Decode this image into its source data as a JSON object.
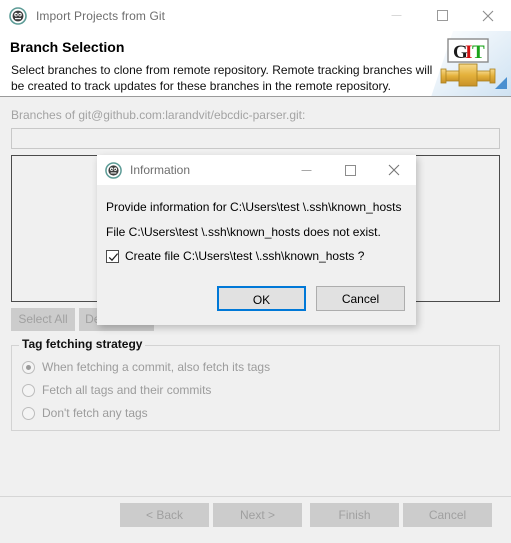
{
  "window": {
    "title": "Import Projects from Git",
    "icon": "git-repository-icon",
    "controls": {
      "minimize": "minimize-icon",
      "maximize": "maximize-icon",
      "close": "close-icon"
    }
  },
  "wizard": {
    "title": "Branch Selection",
    "description": "Select branches to clone from remote repository. Remote tracking branches will be created to track updates for these branches in the remote repository.",
    "banner_icon": "git-banner-icon",
    "banner_letters": {
      "g": "G",
      "i": "I",
      "t": "T"
    }
  },
  "page": {
    "branches_label": "Branches of git@github.com:larandvit/ebcdic-parser.git:",
    "filter_value": "",
    "filter_placeholder": "",
    "branch_list_items": [],
    "select_all_label": "Select All",
    "deselect_all_label": "Deselect All"
  },
  "tag_group": {
    "title": "Tag fetching strategy",
    "options": [
      {
        "label": "When fetching a commit, also fetch its tags",
        "selected": true
      },
      {
        "label": "Fetch all tags and their commits",
        "selected": false
      },
      {
        "label": "Don't fetch any tags",
        "selected": false
      }
    ]
  },
  "footer": {
    "back_label": "< Back",
    "next_label": "Next >",
    "finish_label": "Finish",
    "cancel_label": "Cancel"
  },
  "dialog": {
    "title": "Information",
    "icon": "git-repository-icon",
    "controls": {
      "minimize": "minimize-icon",
      "maximize": "maximize-icon",
      "close": "close-icon"
    },
    "line1": "Provide information for C:\\Users\\test \\.ssh\\known_hosts",
    "line2": "File C:\\Users\\test \\.ssh\\known_hosts does not exist.",
    "checkbox_label": "Create file C:\\Users\\test \\.ssh\\known_hosts ?",
    "checkbox_checked": true,
    "ok_label": "OK",
    "cancel_label": "Cancel"
  },
  "colors": {
    "focus_blue": "#0078d7",
    "dialog_background": "#f0f0f0",
    "titlebar_background": "#ffffff",
    "disabled_text": "#a0a0a0",
    "git_letter_g": "#1a1a1a",
    "git_letter_i": "#d01010",
    "git_letter_t": "#19a319",
    "git_pipe": "#e8b83c"
  }
}
